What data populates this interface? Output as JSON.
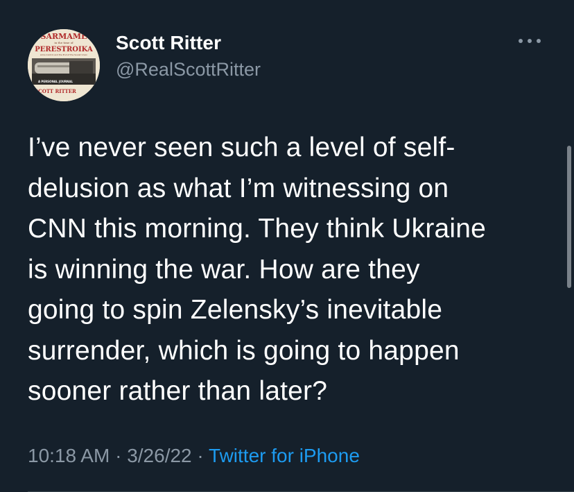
{
  "author": {
    "name": "Scott Ritter",
    "handle": "@RealScottRitter",
    "avatar": {
      "icon": "book-cover-avatar-icon",
      "title_line1": "SARMAME",
      "title_line2": "PERESTROIKA",
      "tagline": "in the time of",
      "subtitle": "Arms Control and the End of the Soviet Union",
      "journal": "A PERSONAL JOURNAL",
      "author_text": "SCOTT RITTER"
    }
  },
  "tweet": {
    "lines": [
      "I’ve never seen such a level of self-",
      "delusion as what I’m witnessing on",
      "CNN this morning. They think Ukraine",
      "is winning the war. How are they",
      "going to spin Zelensky’s inevitable",
      "surrender, which is going to happen",
      "sooner rather than later?"
    ]
  },
  "meta": {
    "time": "10:18 AM",
    "separator": " · ",
    "date": "3/26/22",
    "source": "Twitter for iPhone"
  },
  "colors": {
    "background": "#15202b",
    "secondary_text": "#8b98a5",
    "link": "#1d9bf0",
    "primary_text": "#ffffff"
  }
}
